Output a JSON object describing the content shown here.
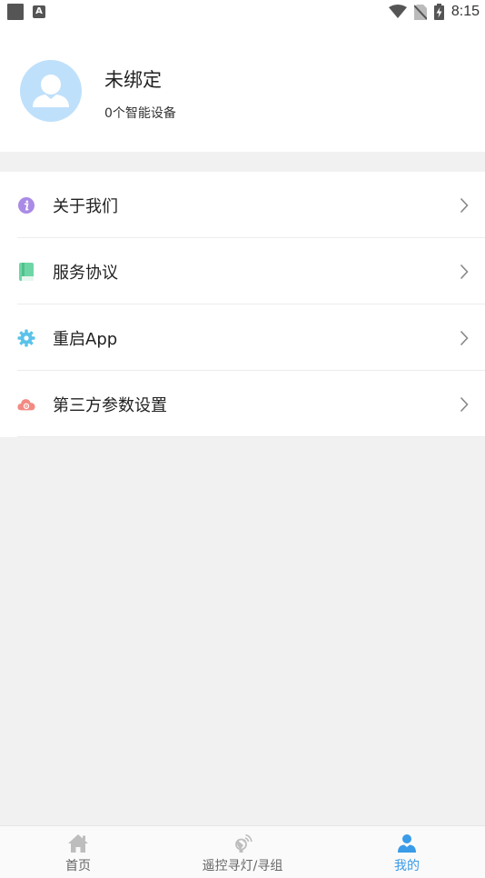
{
  "status_bar": {
    "time": "8:15",
    "keyboard_badge": "A"
  },
  "profile": {
    "name": "未绑定",
    "devices": "0个智能设备"
  },
  "menu": {
    "items": [
      {
        "label": "关于我们",
        "icon": "info-icon",
        "color": "#a98be6"
      },
      {
        "label": "服务协议",
        "icon": "book-icon",
        "color": "#6ed6a6"
      },
      {
        "label": "重启App",
        "icon": "gear-icon",
        "color": "#5bc2ea"
      },
      {
        "label": "第三方参数设置",
        "icon": "cloud-icon",
        "color": "#f28a82"
      }
    ]
  },
  "bottom_nav": {
    "items": [
      {
        "label": "首页",
        "icon": "home-icon",
        "active": false
      },
      {
        "label": "遥控寻灯/寻组",
        "icon": "remote-icon",
        "active": false
      },
      {
        "label": "我的",
        "icon": "user-icon",
        "active": true
      }
    ]
  },
  "colors": {
    "accent": "#3a9be8",
    "avatar_bg": "#bfe0fb",
    "page_bg": "#f1f1f1"
  }
}
